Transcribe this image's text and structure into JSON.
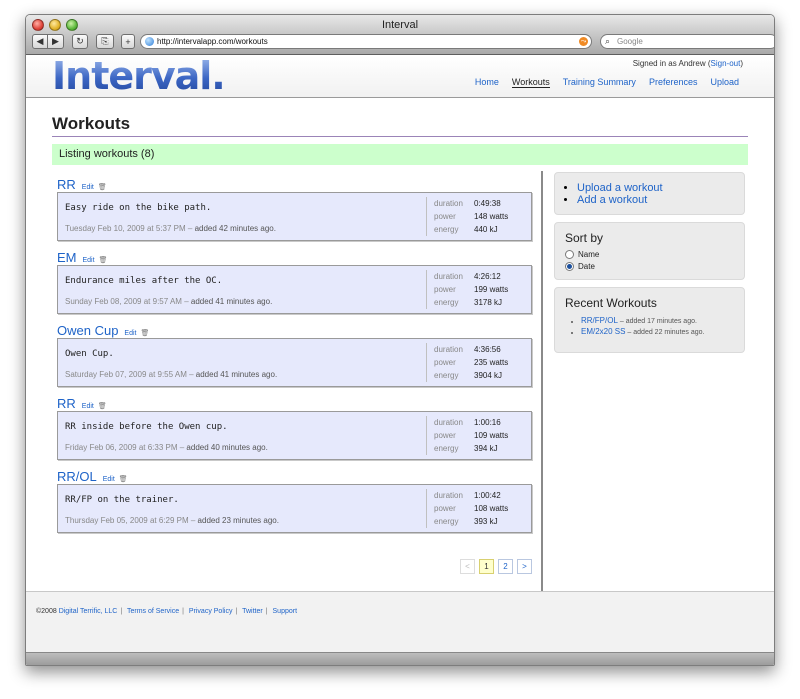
{
  "window": {
    "title": "Interval"
  },
  "browser": {
    "url": "http://intervalapp.com/workouts",
    "search_placeholder": "Google",
    "back_label": "◀",
    "forward_label": "▶",
    "reload_label": "↻",
    "bookmark_label": "⎘",
    "add_label": "+"
  },
  "header": {
    "logo": "Interval.",
    "signed_in": "Signed in as Andrew",
    "sign_out": "Sign-out",
    "nav": [
      "Home",
      "Workouts",
      "Training Summary",
      "Preferences",
      "Upload"
    ],
    "active_nav": "Workouts"
  },
  "page": {
    "title": "Workouts",
    "listing": "Listing workouts (8)"
  },
  "labels": {
    "duration": "duration",
    "power": "power",
    "energy": "energy",
    "edit": "Edit"
  },
  "workouts": [
    {
      "title": "RR",
      "description": "Easy ride on the bike path.",
      "date": "Tuesday Feb 10, 2009 at 5:37 PM",
      "added": "added 42 minutes ago.",
      "duration": "0:49:38",
      "power": "148 watts",
      "energy": "440 kJ"
    },
    {
      "title": "EM",
      "description": "Endurance miles after the OC.",
      "date": "Sunday Feb 08, 2009 at 9:57 AM",
      "added": "added 41 minutes ago.",
      "duration": "4:26:12",
      "power": "199 watts",
      "energy": "3178 kJ"
    },
    {
      "title": "Owen Cup",
      "description": "Owen Cup.",
      "date": "Saturday Feb 07, 2009 at 9:55 AM",
      "added": "added 41 minutes ago.",
      "duration": "4:36:56",
      "power": "235 watts",
      "energy": "3904 kJ"
    },
    {
      "title": "RR",
      "description": "RR inside before the Owen cup.",
      "date": "Friday Feb 06, 2009 at 6:33 PM",
      "added": "added 40 minutes ago.",
      "duration": "1:00:16",
      "power": "109 watts",
      "energy": "394 kJ"
    },
    {
      "title": "RR/OL",
      "description": "RR/FP on the trainer.",
      "date": "Thursday Feb 05, 2009 at 6:29 PM",
      "added": "added 23 minutes ago.",
      "duration": "1:00:42",
      "power": "108 watts",
      "energy": "393 kJ"
    }
  ],
  "pager": {
    "prev": "<",
    "pages": [
      "1",
      "2"
    ],
    "current": "1",
    "next": ">"
  },
  "sidebar": {
    "links": [
      "Upload a workout",
      "Add a workout"
    ],
    "sort_title": "Sort by",
    "sort_options": [
      "Name",
      "Date"
    ],
    "sort_selected": "Date",
    "recent_title": "Recent Workouts",
    "recent": [
      {
        "name": "RR/FP/OL",
        "added": "added 17 minutes ago."
      },
      {
        "name": "EM/2x20 SS",
        "added": "added 22 minutes ago."
      }
    ]
  },
  "footer": {
    "copyright": "©2008",
    "links": [
      "Digital Terrific, LLC",
      "Terms of Service",
      "Privacy Policy",
      "Twitter",
      "Support"
    ]
  },
  "colors": {
    "accent": "#1e63c8",
    "listing_bg": "#ccffcc",
    "workout_bg": "#e6e9fc",
    "current_page_bg": "#ffffcc"
  }
}
